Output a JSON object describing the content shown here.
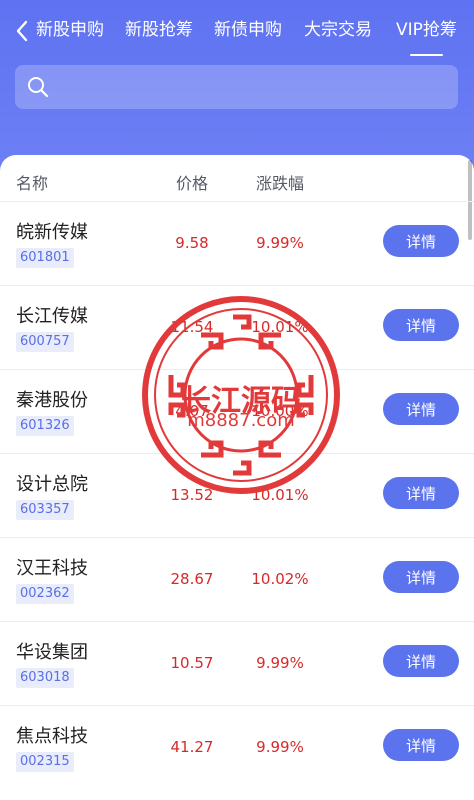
{
  "nav": {
    "tabs": [
      {
        "label": "新股申购"
      },
      {
        "label": "新股抢筹"
      },
      {
        "label": "新债申购"
      },
      {
        "label": "大宗交易"
      },
      {
        "label": "VIP抢筹"
      }
    ],
    "active_tab_index": 4
  },
  "search": {
    "placeholder": ""
  },
  "table": {
    "headers": {
      "name": "名称",
      "price": "价格",
      "change": "涨跌幅"
    },
    "detail_label": "详情",
    "rows": [
      {
        "name": "皖新传媒",
        "code": "601801",
        "price": "9.58",
        "change": "9.99%"
      },
      {
        "name": "长江传媒",
        "code": "600757",
        "price": "11.54",
        "change": "10.01%"
      },
      {
        "name": "秦港股份",
        "code": "601326",
        "price": "4.07",
        "change": "10.00%"
      },
      {
        "name": "设计总院",
        "code": "603357",
        "price": "13.52",
        "change": "10.01%"
      },
      {
        "name": "汉王科技",
        "code": "002362",
        "price": "28.67",
        "change": "10.02%"
      },
      {
        "name": "华设集团",
        "code": "603018",
        "price": "10.57",
        "change": "9.99%"
      },
      {
        "name": "焦点科技",
        "code": "002315",
        "price": "41.27",
        "change": "9.99%"
      }
    ]
  },
  "watermark": {
    "title": "长江源码",
    "url": "m8887.com"
  },
  "colors": {
    "header": "#5f72f2",
    "accent": "#5c73ee",
    "rise": "#d62a2a",
    "watermark": "#e23a3a"
  }
}
